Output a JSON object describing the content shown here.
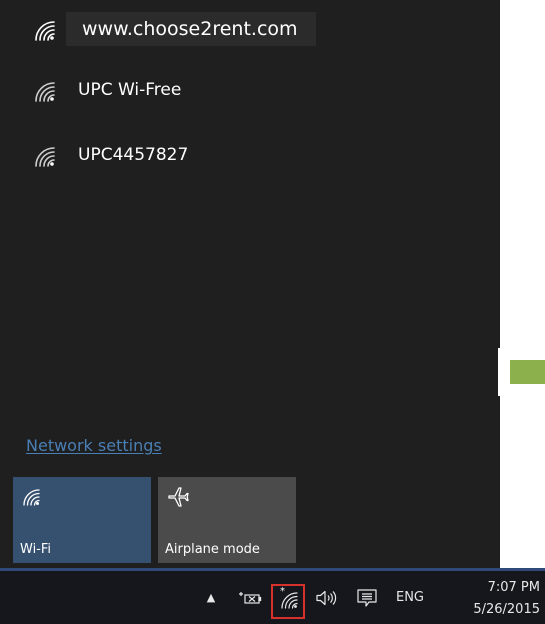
{
  "networks": [
    {
      "ssid": "www.choose2rent.com",
      "icon": "wifi-icon"
    },
    {
      "ssid": "UPC Wi-Free",
      "icon": "wifi-icon"
    },
    {
      "ssid": "UPC4457827",
      "icon": "wifi-icon"
    }
  ],
  "network_settings_link": "Network settings",
  "quick_actions": {
    "wifi": {
      "label": "Wi-Fi",
      "icon": "wifi-icon",
      "color": "#36506f"
    },
    "airplane": {
      "label": "Airplane mode",
      "icon": "airplane-icon",
      "color": "#4b4b4b"
    }
  },
  "taskbar": {
    "language": "ENG",
    "time": "7:07 PM",
    "date": "5/26/2015",
    "icons": [
      "chevron-up-icon",
      "battery-icon",
      "wifi-tray-icon",
      "volume-icon",
      "notifications-icon"
    ],
    "highlight_color": "#d6312c"
  },
  "colors": {
    "flyout_bg": "#1f1f1f",
    "link": "#4a7fb5",
    "accent_square": "#8bb04c",
    "taskbar_bg": "#16171c"
  }
}
